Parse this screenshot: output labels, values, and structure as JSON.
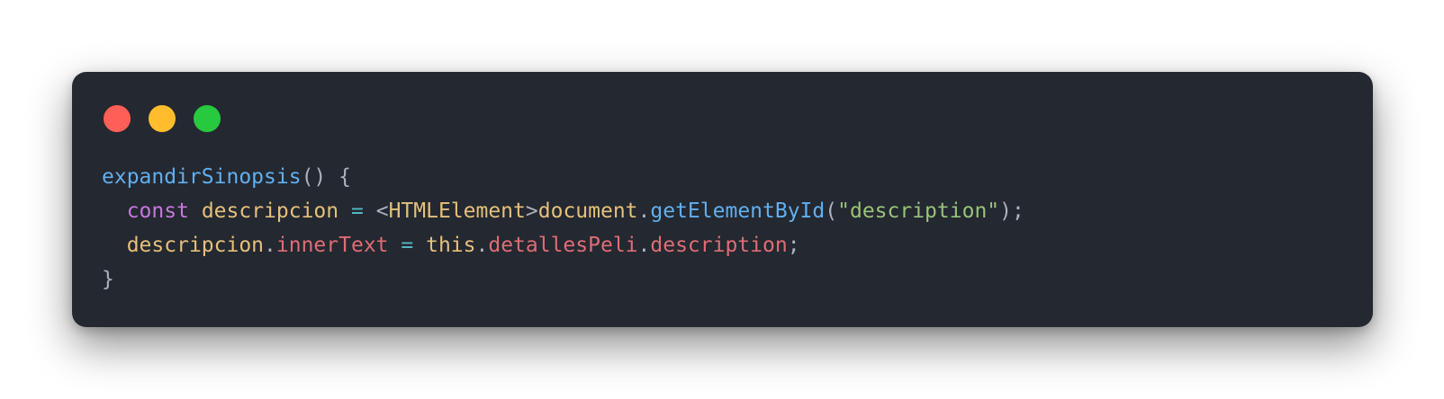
{
  "window": {
    "controls": [
      {
        "name": "close",
        "color": "#ff5f56"
      },
      {
        "name": "minimize",
        "color": "#ffbd2e"
      },
      {
        "name": "maximize",
        "color": "#27c93f"
      }
    ]
  },
  "code": {
    "lines": [
      [
        {
          "t": "expandirSinopsis",
          "k": "function"
        },
        {
          "t": "() {",
          "k": "punct"
        }
      ],
      [
        {
          "t": "  ",
          "k": "punct"
        },
        {
          "t": "const",
          "k": "keyword"
        },
        {
          "t": " ",
          "k": "punct"
        },
        {
          "t": "descripcion",
          "k": "variable"
        },
        {
          "t": " ",
          "k": "punct"
        },
        {
          "t": "=",
          "k": "operator"
        },
        {
          "t": " <",
          "k": "punct"
        },
        {
          "t": "HTMLElement",
          "k": "type"
        },
        {
          "t": ">",
          "k": "punct"
        },
        {
          "t": "document",
          "k": "variable"
        },
        {
          "t": ".",
          "k": "punct"
        },
        {
          "t": "getElementById",
          "k": "function"
        },
        {
          "t": "(",
          "k": "punct"
        },
        {
          "t": "\"description\"",
          "k": "string"
        },
        {
          "t": ");",
          "k": "punct"
        }
      ],
      [
        {
          "t": "  ",
          "k": "punct"
        },
        {
          "t": "descripcion",
          "k": "variable"
        },
        {
          "t": ".",
          "k": "punct"
        },
        {
          "t": "innerText",
          "k": "property"
        },
        {
          "t": " ",
          "k": "punct"
        },
        {
          "t": "=",
          "k": "operator"
        },
        {
          "t": " ",
          "k": "punct"
        },
        {
          "t": "this",
          "k": "this"
        },
        {
          "t": ".",
          "k": "punct"
        },
        {
          "t": "detallesPeli",
          "k": "property"
        },
        {
          "t": ".",
          "k": "punct"
        },
        {
          "t": "description",
          "k": "property"
        },
        {
          "t": ";",
          "k": "punct"
        }
      ],
      [
        {
          "t": "}",
          "k": "punct"
        }
      ]
    ]
  }
}
